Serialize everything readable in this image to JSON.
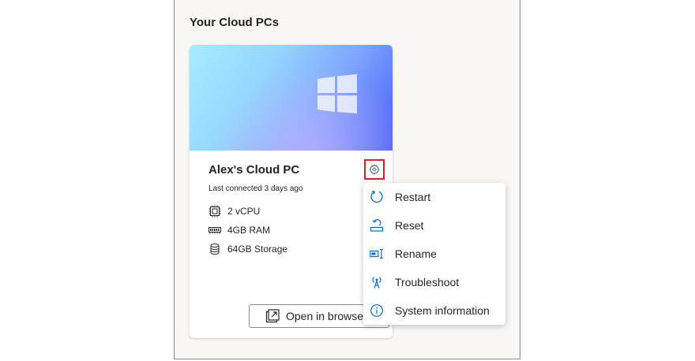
{
  "panel": {
    "title": "Your Cloud PCs"
  },
  "card": {
    "name": "Alex's Cloud PC",
    "last_connected": "Last connected 3 days ago",
    "specs": [
      {
        "icon": "cpu-icon",
        "label": "2 vCPU"
      },
      {
        "icon": "ram-icon",
        "label": "4GB RAM"
      },
      {
        "icon": "storage-icon",
        "label": "64GB Storage"
      }
    ],
    "open_button_label": "Open in browser"
  },
  "menu": {
    "items": [
      {
        "icon": "restart-icon",
        "label": "Restart"
      },
      {
        "icon": "reset-icon",
        "label": "Reset"
      },
      {
        "icon": "rename-icon",
        "label": "Rename"
      },
      {
        "icon": "troubleshoot-icon",
        "label": "Troubleshoot"
      },
      {
        "icon": "info-icon",
        "label": "System information"
      }
    ]
  },
  "colors": {
    "accent": "#0f6cbd",
    "highlight_border": "#e51b2b"
  }
}
